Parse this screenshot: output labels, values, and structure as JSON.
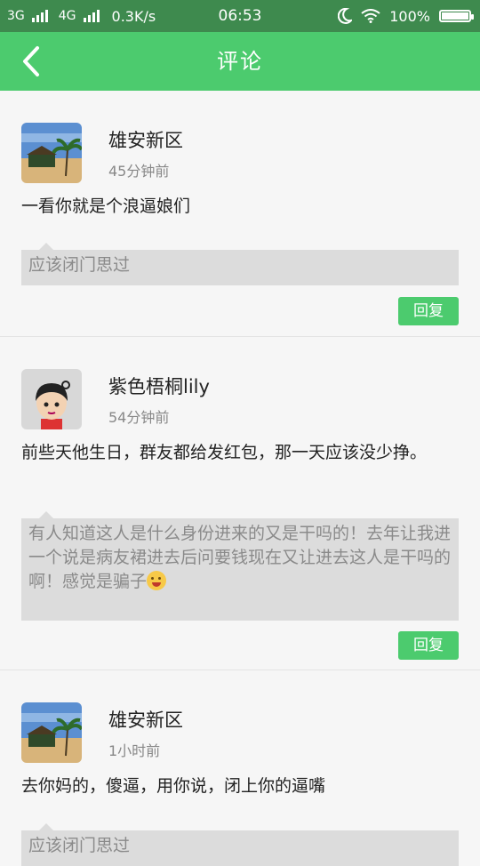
{
  "status_bar": {
    "network1": "3G",
    "network2": "4G",
    "speed": "0.3K/s",
    "time": "06:53",
    "battery_text": "100%",
    "battery_level": 1.0
  },
  "header": {
    "title": "评论"
  },
  "comments": [
    {
      "author": "雄安新区",
      "time": "45分钟前",
      "text": "一看你就是个浪逼娘们",
      "quote": "应该闭门思过",
      "reply_label": "回复",
      "avatar": "beach-photo"
    },
    {
      "author": "紫色梧桐lily",
      "time": "54分钟前",
      "text": "前些天他生日，群友都给发红包，那一天应该没少挣。",
      "quote": "有人知道这人是什么身份进来的又是干吗的！去年让我进一个说是病友裙进去后问要钱现在又让进去这人是干吗的啊！感觉是骗子",
      "reply_label": "回复",
      "avatar": "cartoon-boy"
    },
    {
      "author": "雄安新区",
      "time": "1小时前",
      "text": "去你妈的，傻逼，用你说，闭上你的逼嘴",
      "quote": "应该闭门思过",
      "avatar": "beach-photo"
    }
  ],
  "colors": {
    "status_bar": "#3e8a4e",
    "header": "#4ccb6e",
    "reply_button": "#4ccb6e"
  }
}
